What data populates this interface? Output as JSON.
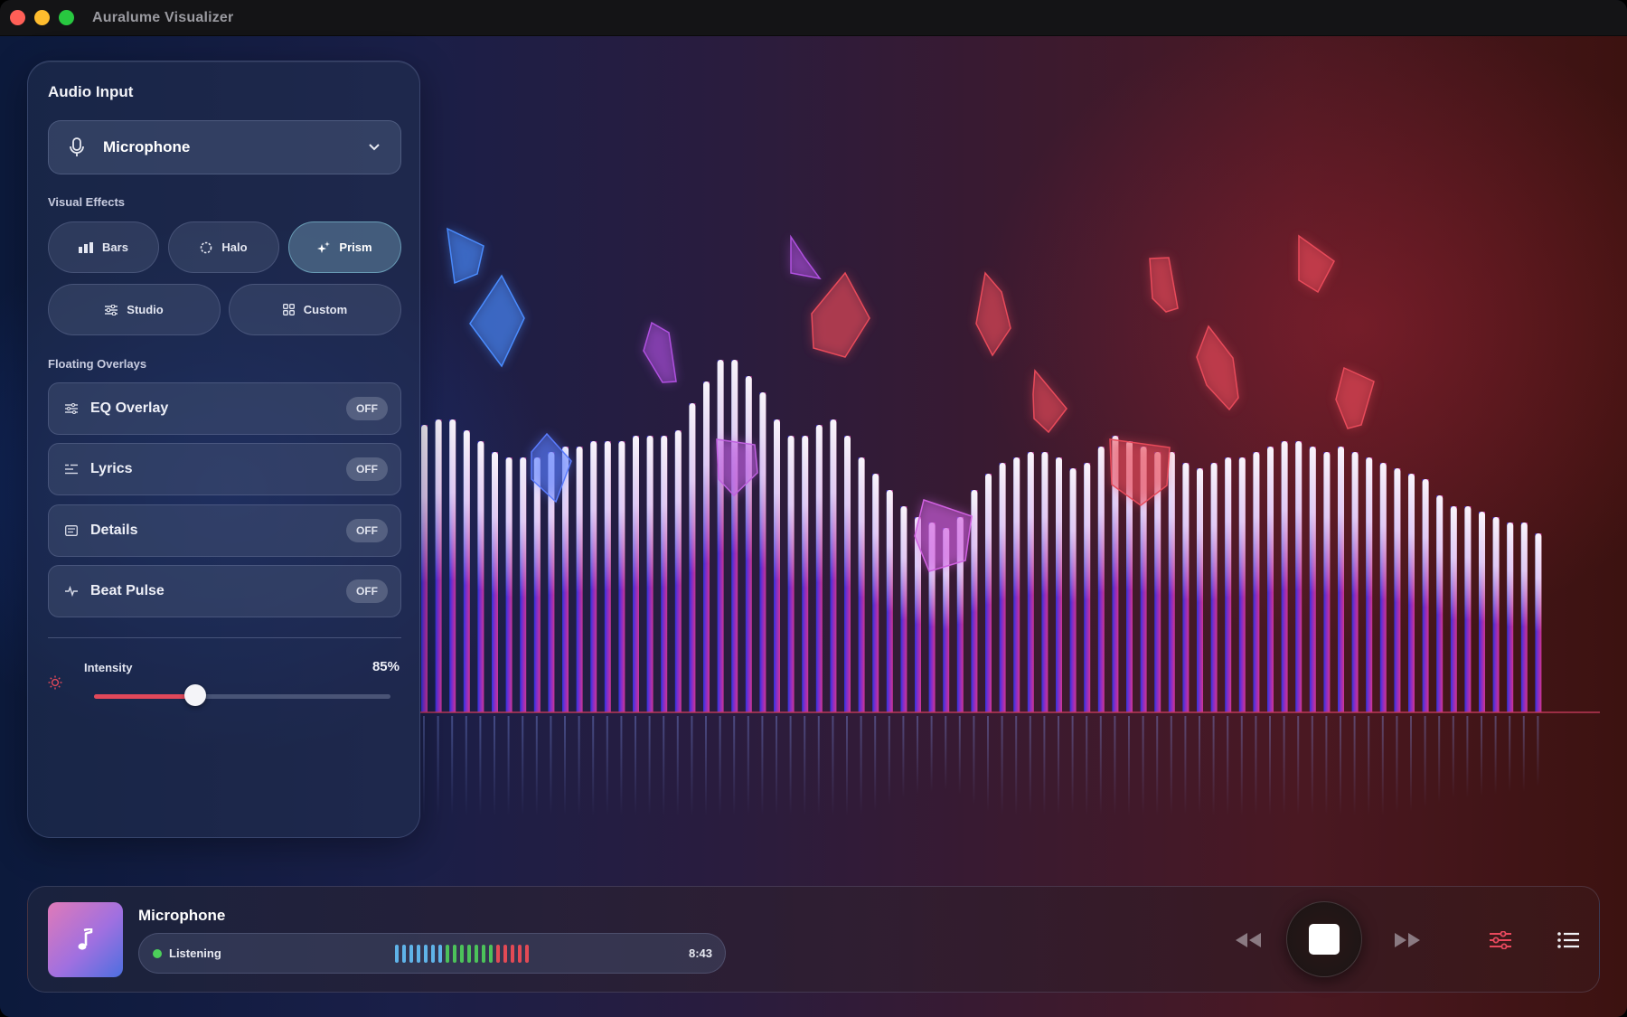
{
  "app": {
    "title": "Auralume Visualizer"
  },
  "sidebar": {
    "audio_input_title": "Audio Input",
    "source": {
      "label": "Microphone",
      "icon": "microphone-icon"
    },
    "visual_effects_title": "Visual Effects",
    "effects": [
      {
        "label": "Bars",
        "icon": "bars-icon",
        "active": false
      },
      {
        "label": "Halo",
        "icon": "halo-icon",
        "active": false
      },
      {
        "label": "Prism",
        "icon": "sparkle-icon",
        "active": true
      },
      {
        "label": "Studio",
        "icon": "sliders-icon",
        "active": false
      },
      {
        "label": "Custom",
        "icon": "grid-icon",
        "active": false
      }
    ],
    "floating_overlays_title": "Floating Overlays",
    "overlays": [
      {
        "label": "EQ Overlay",
        "state": "OFF",
        "icon": "equalizer-icon"
      },
      {
        "label": "Lyrics",
        "state": "OFF",
        "icon": "lyrics-icon"
      },
      {
        "label": "Details",
        "state": "OFF",
        "icon": "details-icon"
      },
      {
        "label": "Beat Pulse",
        "state": "OFF",
        "icon": "pulse-icon"
      }
    ],
    "intensity": {
      "label": "Intensity",
      "value_text": "85%",
      "slider_fraction": 0.34
    }
  },
  "player": {
    "track_title": "Microphone",
    "status": "Listening",
    "time": "8:43",
    "meter_colors": [
      "#5fb3e8",
      "#5fb3e8",
      "#5fb3e8",
      "#5fb3e8",
      "#5fb3e8",
      "#5fb3e8",
      "#5fb3e8",
      "#4cc25a",
      "#4cc25a",
      "#4cc25a",
      "#4cc25a",
      "#4cc25a",
      "#4cc25a",
      "#4cc25a",
      "#e24a55",
      "#e24a55",
      "#e24a55",
      "#e24a55",
      "#e24a55"
    ],
    "controls": [
      "rewind-icon",
      "stop-icon",
      "fast-forward-icon",
      "equalizer-settings-icon",
      "playlist-icon"
    ]
  },
  "visualizer": {
    "bar_levels": [
      0.53,
      0.54,
      0.54,
      0.52,
      0.5,
      0.48,
      0.47,
      0.47,
      0.47,
      0.48,
      0.49,
      0.49,
      0.5,
      0.5,
      0.5,
      0.51,
      0.51,
      0.51,
      0.52,
      0.57,
      0.61,
      0.65,
      0.65,
      0.62,
      0.59,
      0.54,
      0.51,
      0.51,
      0.53,
      0.54,
      0.51,
      0.47,
      0.44,
      0.41,
      0.38,
      0.36,
      0.35,
      0.34,
      0.36,
      0.41,
      0.44,
      0.46,
      0.47,
      0.48,
      0.48,
      0.47,
      0.45,
      0.46,
      0.49,
      0.51,
      0.5,
      0.49,
      0.48,
      0.48,
      0.46,
      0.45,
      0.46,
      0.47,
      0.47,
      0.48,
      0.49,
      0.5,
      0.5,
      0.49,
      0.48,
      0.49,
      0.48,
      0.47,
      0.46,
      0.45,
      0.44,
      0.43,
      0.4,
      0.38,
      0.38,
      0.37,
      0.36,
      0.35,
      0.35,
      0.33
    ],
    "accent_colors": {
      "left": "#2a3cf0",
      "middle": "#8a2ee0",
      "right": "#e23aa0"
    }
  }
}
